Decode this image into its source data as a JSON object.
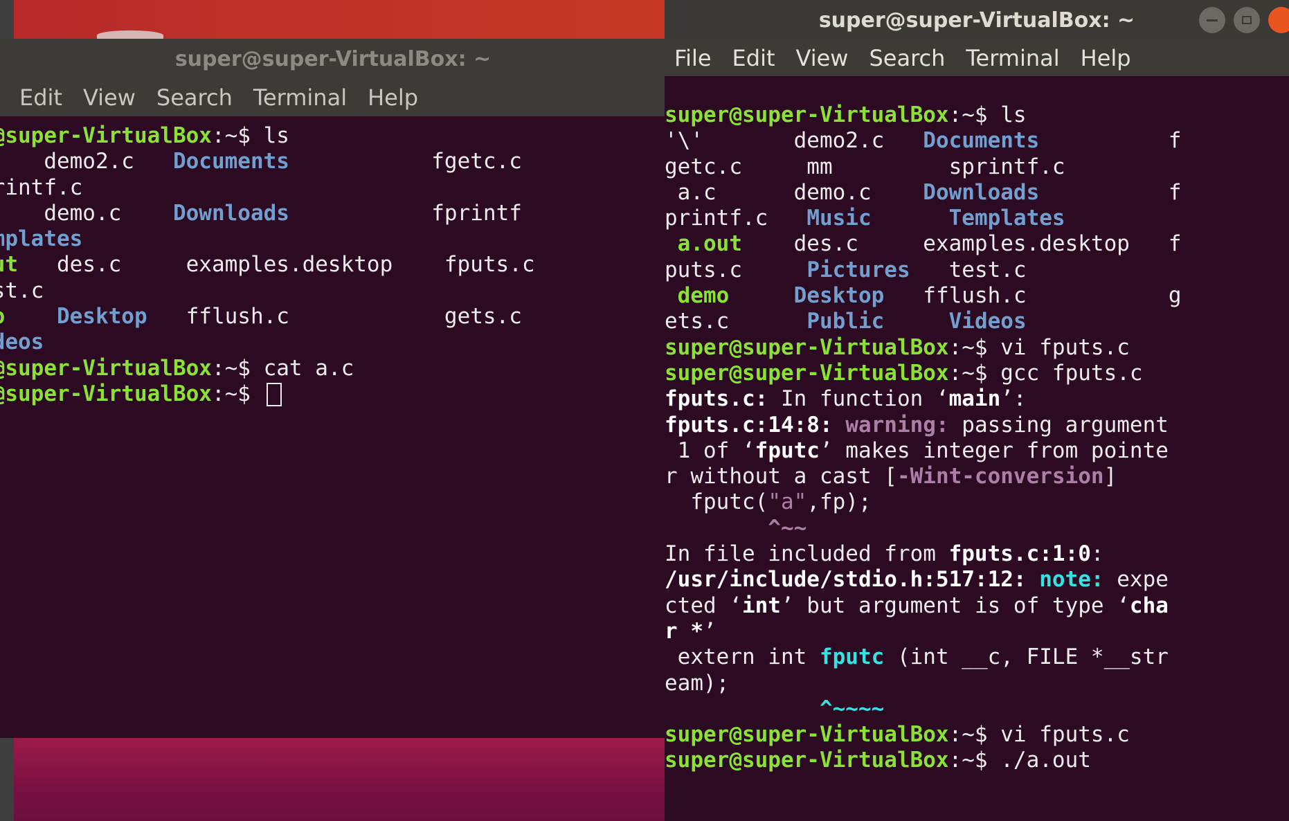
{
  "colors": {
    "terminal_bg": "#2c0a22",
    "prompt": "#8ae234",
    "directory": "#729fcf",
    "executable": "#8ae234",
    "warning": "#ad7fa8",
    "note": "#34e2e2",
    "titlebar": "#3c3b37",
    "close_button": "#e95420"
  },
  "left_window": {
    "title": "super@super-VirtualBox: ~",
    "menu": [
      "Edit",
      "View",
      "Search",
      "Terminal",
      "Help"
    ],
    "lines": [
      [
        {
          "t": "r@super-VirtualBox",
          "c": "prompt"
        },
        {
          "t": ":~$ ls",
          "c": "prompt-end"
        }
      ],
      [
        {
          "t": "     demo2.c   ",
          "c": ""
        },
        {
          "t": "Documents",
          "c": "dir"
        },
        {
          "t": "           fgetc.c",
          "c": ""
        }
      ],
      [
        {
          "t": "printf.c",
          "c": ""
        }
      ],
      [
        {
          "t": "     demo.c    ",
          "c": ""
        },
        {
          "t": "Downloads",
          "c": "dir"
        },
        {
          "t": "           fprintf",
          "c": ""
        }
      ],
      [
        {
          "t": "emplates",
          "c": "dir"
        }
      ],
      [
        {
          "t": "out",
          "c": "exe"
        },
        {
          "t": "   des.c     examples.desktop    fputs.c",
          "c": ""
        }
      ],
      [
        {
          "t": "est.c",
          "c": ""
        }
      ],
      [
        {
          "t": "mo",
          "c": "exe"
        },
        {
          "t": "    ",
          "c": ""
        },
        {
          "t": "Desktop",
          "c": "dir"
        },
        {
          "t": "   fflush.c            gets.c",
          "c": ""
        }
      ],
      [
        {
          "t": "ideos",
          "c": "dir"
        }
      ],
      [
        {
          "t": "r@super-VirtualBox",
          "c": "prompt"
        },
        {
          "t": ":~$ cat a.c",
          "c": "prompt-end"
        }
      ],
      [
        {
          "t": "r@super-VirtualBox",
          "c": "prompt"
        },
        {
          "t": ":~$ ",
          "c": "prompt-end"
        },
        {
          "t": "",
          "c": "cursor"
        }
      ]
    ]
  },
  "right_window": {
    "title": "super@super-VirtualBox: ~",
    "menu": [
      "File",
      "Edit",
      "View",
      "Search",
      "Terminal",
      "Help"
    ],
    "lines": [
      [
        {
          "t": "super@super-VirtualBox",
          "c": "prompt"
        },
        {
          "t": ":~$ ls",
          "c": "prompt-end"
        }
      ],
      [
        {
          "t": "'\\'       demo2.c   ",
          "c": ""
        },
        {
          "t": "Documents",
          "c": "dir"
        },
        {
          "t": "          f",
          "c": ""
        }
      ],
      [
        {
          "t": "getc.c     mm         sprintf.c",
          "c": ""
        }
      ],
      [
        {
          "t": " a.c      demo.c    ",
          "c": ""
        },
        {
          "t": "Downloads",
          "c": "dir"
        },
        {
          "t": "          f",
          "c": ""
        }
      ],
      [
        {
          "t": "printf.c   ",
          "c": ""
        },
        {
          "t": "Music",
          "c": "dir"
        },
        {
          "t": "      ",
          "c": ""
        },
        {
          "t": "Templates",
          "c": "dir"
        }
      ],
      [
        {
          "t": " a.out",
          "c": "exe"
        },
        {
          "t": "    des.c     examples.desktop   f",
          "c": ""
        }
      ],
      [
        {
          "t": "puts.c     ",
          "c": ""
        },
        {
          "t": "Pictures",
          "c": "dir"
        },
        {
          "t": "   test.c",
          "c": ""
        }
      ],
      [
        {
          "t": " demo",
          "c": "exe"
        },
        {
          "t": "     ",
          "c": ""
        },
        {
          "t": "Desktop",
          "c": "dir"
        },
        {
          "t": "   fflush.c           g",
          "c": ""
        }
      ],
      [
        {
          "t": "ets.c      ",
          "c": ""
        },
        {
          "t": "Public",
          "c": "dir"
        },
        {
          "t": "     ",
          "c": ""
        },
        {
          "t": "Videos",
          "c": "dir"
        }
      ],
      [
        {
          "t": "super@super-VirtualBox",
          "c": "prompt"
        },
        {
          "t": ":~$ vi fputs.c",
          "c": "prompt-end"
        }
      ],
      [
        {
          "t": "super@super-VirtualBox",
          "c": "prompt"
        },
        {
          "t": ":~$ gcc fputs.c",
          "c": "prompt-end"
        }
      ],
      [
        {
          "t": "fputs.c:",
          "c": "bold"
        },
        {
          "t": " In function ‘",
          "c": ""
        },
        {
          "t": "main",
          "c": "bold"
        },
        {
          "t": "’:",
          "c": ""
        }
      ],
      [
        {
          "t": "fputs.c:14:8:",
          "c": "bold"
        },
        {
          "t": " ",
          "c": ""
        },
        {
          "t": "warning:",
          "c": "warn"
        },
        {
          "t": " passing argument",
          "c": ""
        }
      ],
      [
        {
          "t": " 1 of ‘",
          "c": ""
        },
        {
          "t": "fputc",
          "c": "bold"
        },
        {
          "t": "’ makes integer from pointe",
          "c": ""
        }
      ],
      [
        {
          "t": "r without a cast [",
          "c": ""
        },
        {
          "t": "-Wint-conversion",
          "c": "warn"
        },
        {
          "t": "]",
          "c": ""
        }
      ],
      [
        {
          "t": "  fputc(",
          "c": ""
        },
        {
          "t": "\"a\"",
          "c": "quote-str"
        },
        {
          "t": ",fp);",
          "c": ""
        }
      ],
      [
        {
          "t": "        ^~~",
          "c": "warn"
        }
      ],
      [
        {
          "t": "In file included from ",
          "c": ""
        },
        {
          "t": "fputs.c:1:0",
          "c": "bold"
        },
        {
          "t": ":",
          "c": ""
        }
      ],
      [
        {
          "t": "/usr/include/stdio.h:517:12:",
          "c": "bold"
        },
        {
          "t": " ",
          "c": ""
        },
        {
          "t": "note:",
          "c": "note"
        },
        {
          "t": " expe",
          "c": ""
        }
      ],
      [
        {
          "t": "cted ‘",
          "c": ""
        },
        {
          "t": "int",
          "c": "bold"
        },
        {
          "t": "’ but argument is of type ‘",
          "c": ""
        },
        {
          "t": "cha",
          "c": "bold"
        }
      ],
      [
        {
          "t": "r *",
          "c": "bold"
        },
        {
          "t": "’",
          "c": ""
        }
      ],
      [
        {
          "t": " extern int ",
          "c": ""
        },
        {
          "t": "fputc",
          "c": "note"
        },
        {
          "t": " (int __c, FILE *__str",
          "c": ""
        }
      ],
      [
        {
          "t": "eam);",
          "c": ""
        }
      ],
      [
        {
          "t": "            ^~~~~",
          "c": "note"
        }
      ],
      [
        {
          "t": "super@super-VirtualBox",
          "c": "prompt"
        },
        {
          "t": ":~$ vi fputs.c",
          "c": "prompt-end"
        }
      ],
      [
        {
          "t": "super@super-VirtualBox",
          "c": "prompt"
        },
        {
          "t": ":~$ ./a.out",
          "c": "prompt-end"
        }
      ]
    ]
  }
}
